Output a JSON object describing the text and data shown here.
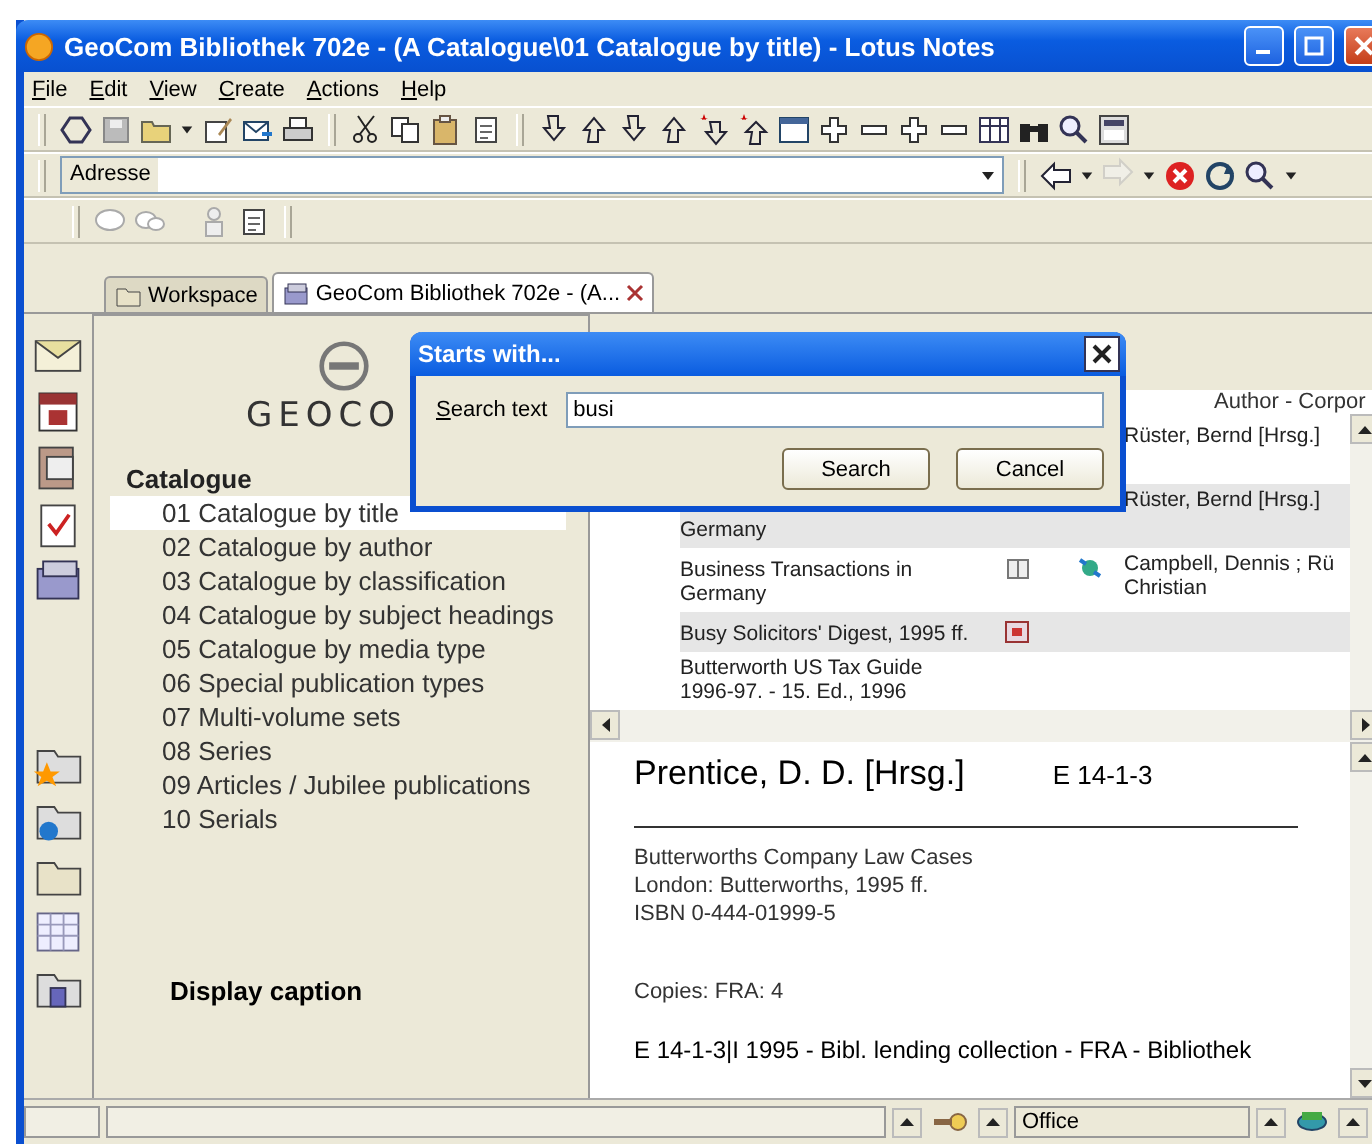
{
  "window": {
    "title": "GeoCom Bibliothek 702e - (A Catalogue\\01 Catalogue by title) - Lotus Notes"
  },
  "menu": [
    {
      "label": "File"
    },
    {
      "label": "Edit"
    },
    {
      "label": "View"
    },
    {
      "label": "Create"
    },
    {
      "label": "Actions"
    },
    {
      "label": "Help"
    }
  ],
  "address": {
    "label": "Adresse"
  },
  "tabs": [
    {
      "label": "Workspace",
      "selected": false,
      "closable": false
    },
    {
      "label": "GeoCom Bibliothek 702e - (A...",
      "selected": true,
      "closable": true
    }
  ],
  "navigator": {
    "logo_text": "GEOCO",
    "heading": "Catalogue",
    "items": [
      {
        "label": "01 Catalogue by title",
        "selected": true
      },
      {
        "label": "02 Catalogue by author",
        "selected": false
      },
      {
        "label": "03 Catalogue by classification",
        "selected": false
      },
      {
        "label": "04 Catalogue by subject headings",
        "selected": false
      },
      {
        "label": "05 Catalogue by media type",
        "selected": false
      },
      {
        "label": "06 Special publication types",
        "selected": false
      },
      {
        "label": "07 Multi-volume sets",
        "selected": false
      },
      {
        "label": "08 Series",
        "selected": false
      },
      {
        "label": "09 Articles / Jubilee publications",
        "selected": false
      },
      {
        "label": "10 Serials",
        "selected": false
      }
    ],
    "caption": "Display caption"
  },
  "view": {
    "column_header": "Author - Corpor",
    "rows": [
      {
        "author": "Rüster, Bernd [Hrsg.]"
      },
      {
        "title": "Germany",
        "author": "Rüster, Bernd [Hrsg.]"
      },
      {
        "title": "Business Transactions in Germany",
        "kind": "book",
        "linked": true,
        "author": "Campbell, Dennis ; Rü Christian"
      },
      {
        "title": "Busy Solicitors' Digest, 1995 ff.",
        "kind": "periodical",
        "linked": false
      },
      {
        "title": "Butterworth US Tax Guide\n1996-97. - 15. Ed., 1996",
        "linked": false
      }
    ]
  },
  "dialog": {
    "title": "Starts with...",
    "label": "Search text",
    "value": "busi",
    "buttons": [
      "Search",
      "Cancel"
    ]
  },
  "preview": {
    "author": "Prentice, D. D. [Hrsg.]",
    "shelfmark": "E 14-1-3",
    "lines": [
      "Butterworths Company Law Cases",
      "London: Butterworths, 1995 ff.",
      "ISBN 0-444-01999-5"
    ],
    "copies": "Copies:  FRA: 4",
    "holding": "E 14-1-3|I 1995 - Bibl. lending collection - FRA - Bibliothek"
  },
  "status": {
    "field": "Office"
  }
}
